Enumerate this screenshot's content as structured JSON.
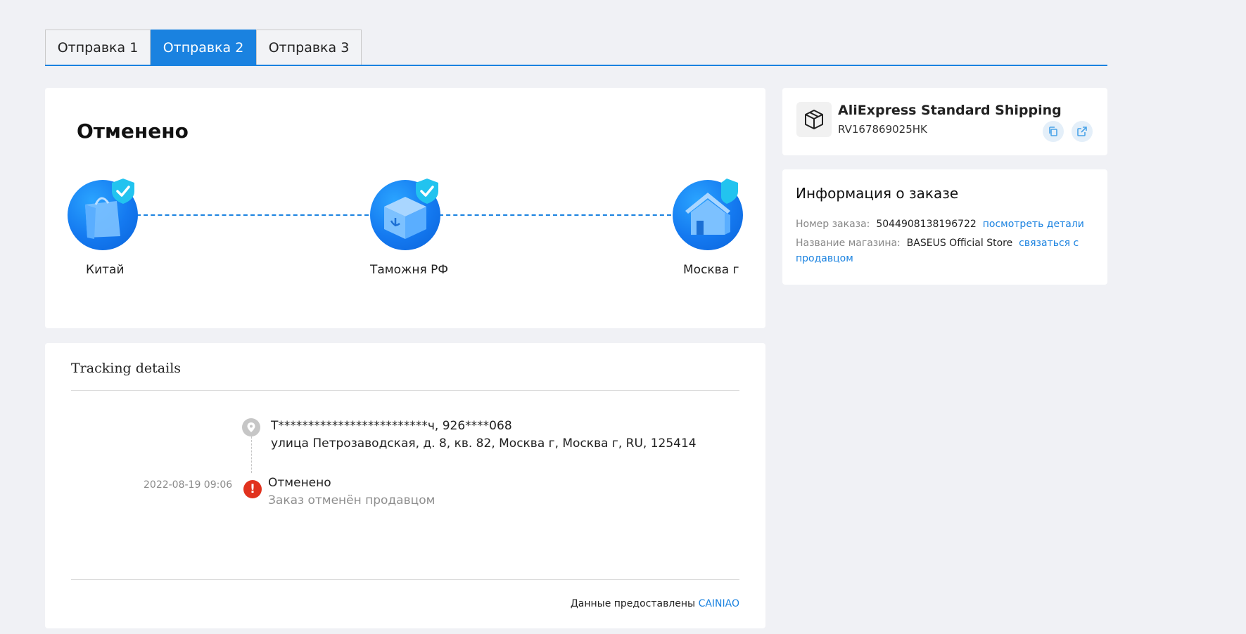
{
  "tabs": [
    {
      "label": "Отправка 1",
      "active": false
    },
    {
      "label": "Отправка 2",
      "active": true
    },
    {
      "label": "Отправка 3",
      "active": false
    }
  ],
  "status": {
    "title": "Отменено",
    "nodes": [
      {
        "label": "Китай",
        "icon": "shopping-bag-icon"
      },
      {
        "label": "Таможня РФ",
        "icon": "customs-box-icon"
      },
      {
        "label": "Москва г",
        "icon": "house-icon"
      }
    ]
  },
  "tracking": {
    "title": "Tracking details",
    "address_line1": "Т*************************ч,  926****068",
    "address_line2": "улица Петрозаводская, д. 8, кв. 82,  Москва г,  Москва г,  RU,  125414",
    "events": [
      {
        "time": "2022-08-19 09:06",
        "title": "Отменено",
        "desc": "Заказ отменён продавцом"
      }
    ],
    "footer_prefix": "Данные предоставлены",
    "footer_link": "CAINIAO"
  },
  "shipping": {
    "carrier": "AliExpress Standard Shipping",
    "tracking_number": "RV167869025HK"
  },
  "order_info": {
    "title": "Информация о заказе",
    "order_number_label": "Номер заказа:",
    "order_number": "5044908138196722",
    "order_details_link": "посмотреть детали",
    "store_label": "Название магазина:",
    "store_name": "BASEUS Official Store",
    "contact_link": "связаться с продавцом"
  },
  "colors": {
    "accent": "#1a82e0",
    "error": "#e1321e",
    "background": "#f0f1f5"
  }
}
